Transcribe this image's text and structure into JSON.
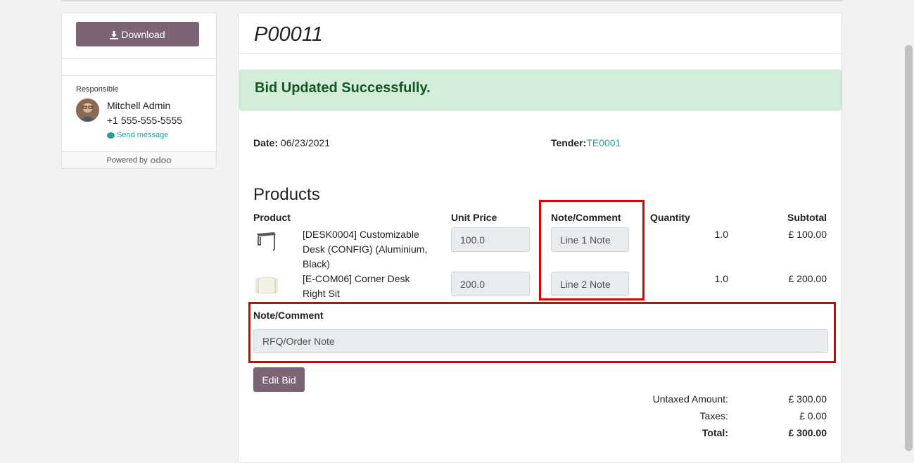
{
  "sidebar": {
    "download_label": "Download",
    "responsible_label": "Responsible",
    "responsible_name": "Mitchell Admin",
    "responsible_phone": "+1 555-555-5555",
    "send_message_label": "Send message",
    "powered_by_label": "Powered by",
    "odoo_logo_text": "odoo"
  },
  "order": {
    "title": "P00011",
    "alert_text": "Bid Updated Successfully.",
    "date_label": "Date:",
    "date_value": "06/23/2021",
    "tender_label": "Tender:",
    "tender_value": "TE0001"
  },
  "products": {
    "heading": "Products",
    "headers": {
      "product": "Product",
      "unit_price": "Unit Price",
      "note": "Note/Comment",
      "quantity": "Quantity",
      "subtotal": "Subtotal"
    },
    "rows": [
      {
        "name": "[DESK0004] Customizable Desk (CONFIG) (Aluminium, Black)",
        "unit_price": "100.0",
        "note": "Line 1 Note",
        "quantity": "1.0",
        "subtotal": "£ 100.00"
      },
      {
        "name": "[E-COM06] Corner Desk Right Sit",
        "unit_price": "200.0",
        "note": "Line 2 Note",
        "quantity": "1.0",
        "subtotal": "£ 200.00"
      }
    ]
  },
  "note_section": {
    "label": "Note/Comment",
    "value": "RFQ/Order Note"
  },
  "edit_label": "Edit Bid",
  "totals": {
    "untaxed_label": "Untaxed Amount:",
    "untaxed_value": "£ 300.00",
    "taxes_label": "Taxes:",
    "taxes_value": "£ 0.00",
    "total_label": "Total:",
    "total_value": "£ 300.00"
  },
  "colors": {
    "primary_button": "#7c6477",
    "link": "#22a0a0",
    "alert_bg": "#d4edda",
    "alert_text": "#155724",
    "highlight": "#e00000"
  }
}
